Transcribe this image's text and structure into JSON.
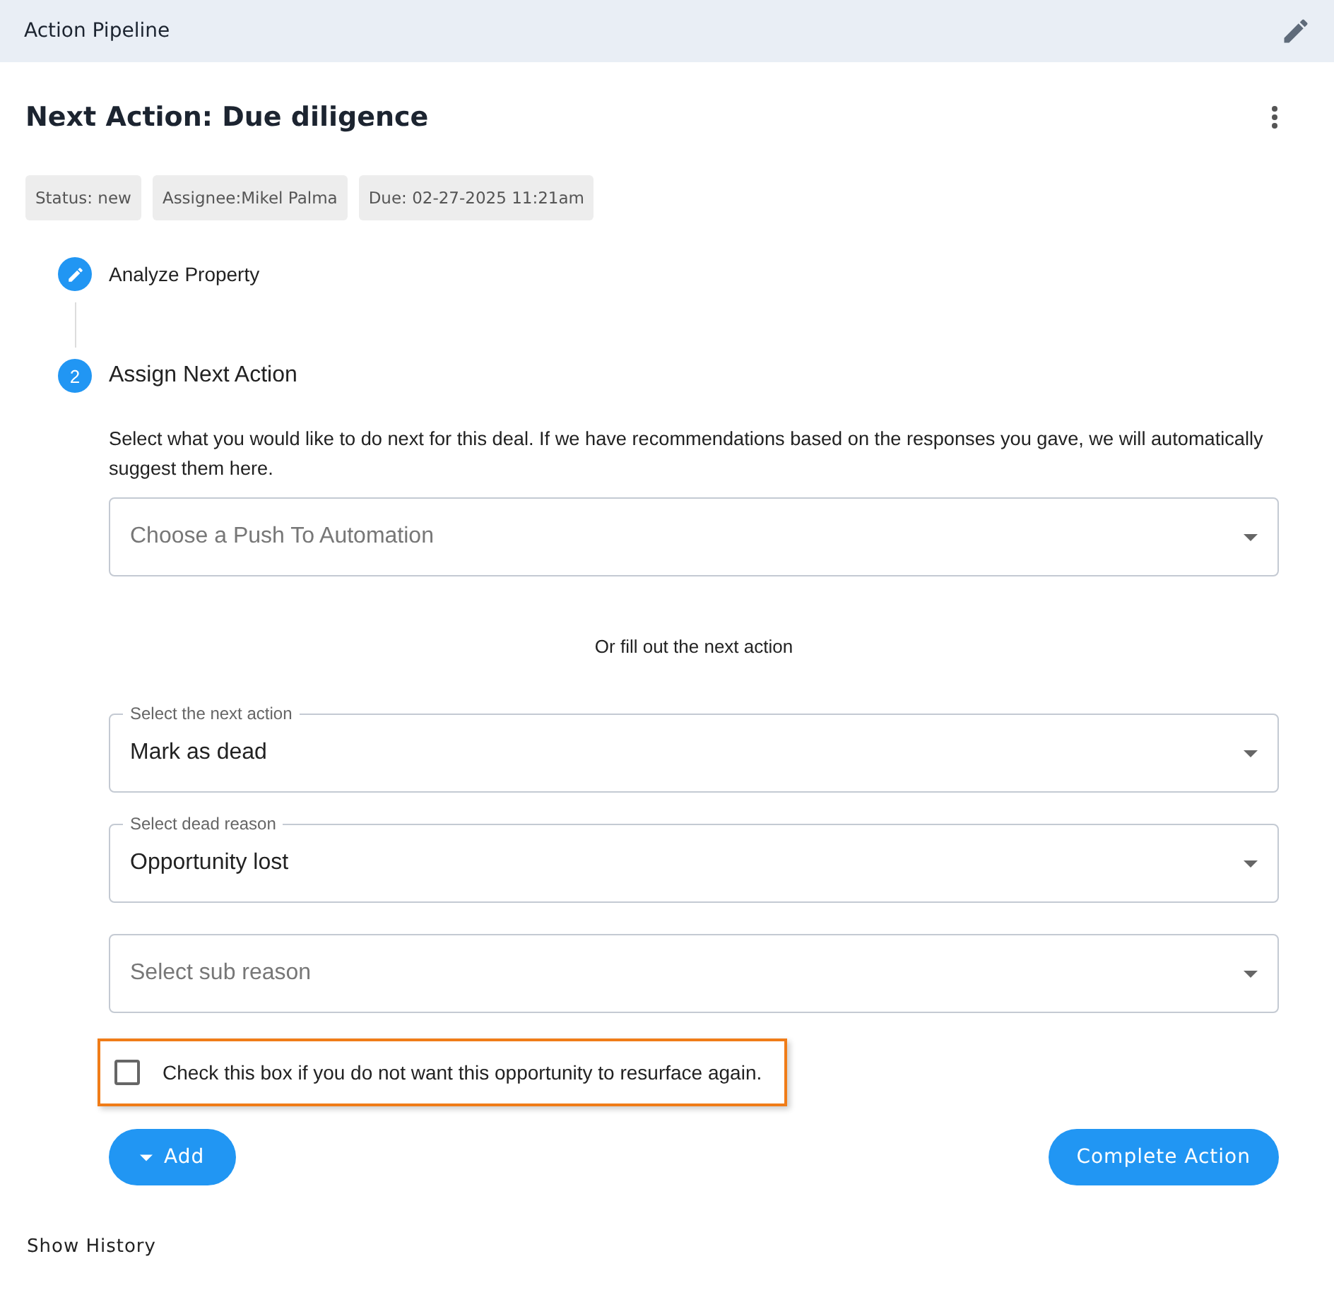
{
  "header": {
    "title": "Action Pipeline"
  },
  "card": {
    "title": "Next Action: Due diligence",
    "chips": [
      "Status: new",
      "Assignee:Mikel Palma",
      "Due: 02-27-2025 11:21am"
    ],
    "steps": [
      {
        "kind": "done",
        "label": "Analyze Property"
      },
      {
        "kind": "active",
        "number": "2",
        "label": "Assign Next Action"
      }
    ],
    "description": "Select what you would like to do next for this deal. If we have recommendations based on the responses you gave, we will automatically suggest them here.",
    "automation_select": {
      "placeholder": "Choose a Push To Automation"
    },
    "separator": "Or fill out the next action",
    "selects": [
      {
        "label": "Select the next action",
        "value": "Mark as dead"
      },
      {
        "label": "Select dead reason",
        "value": "Opportunity lost"
      },
      {
        "placeholder": "Select sub reason"
      }
    ],
    "checkbox": {
      "label": "Check this box if you do not want this opportunity to resurface again.",
      "checked": false,
      "highlighted": true
    },
    "buttons": [
      {
        "kind": "menu",
        "label": "Add"
      },
      {
        "kind": "primary",
        "label": "Complete Action"
      }
    ]
  },
  "footer_link": "Show History"
}
